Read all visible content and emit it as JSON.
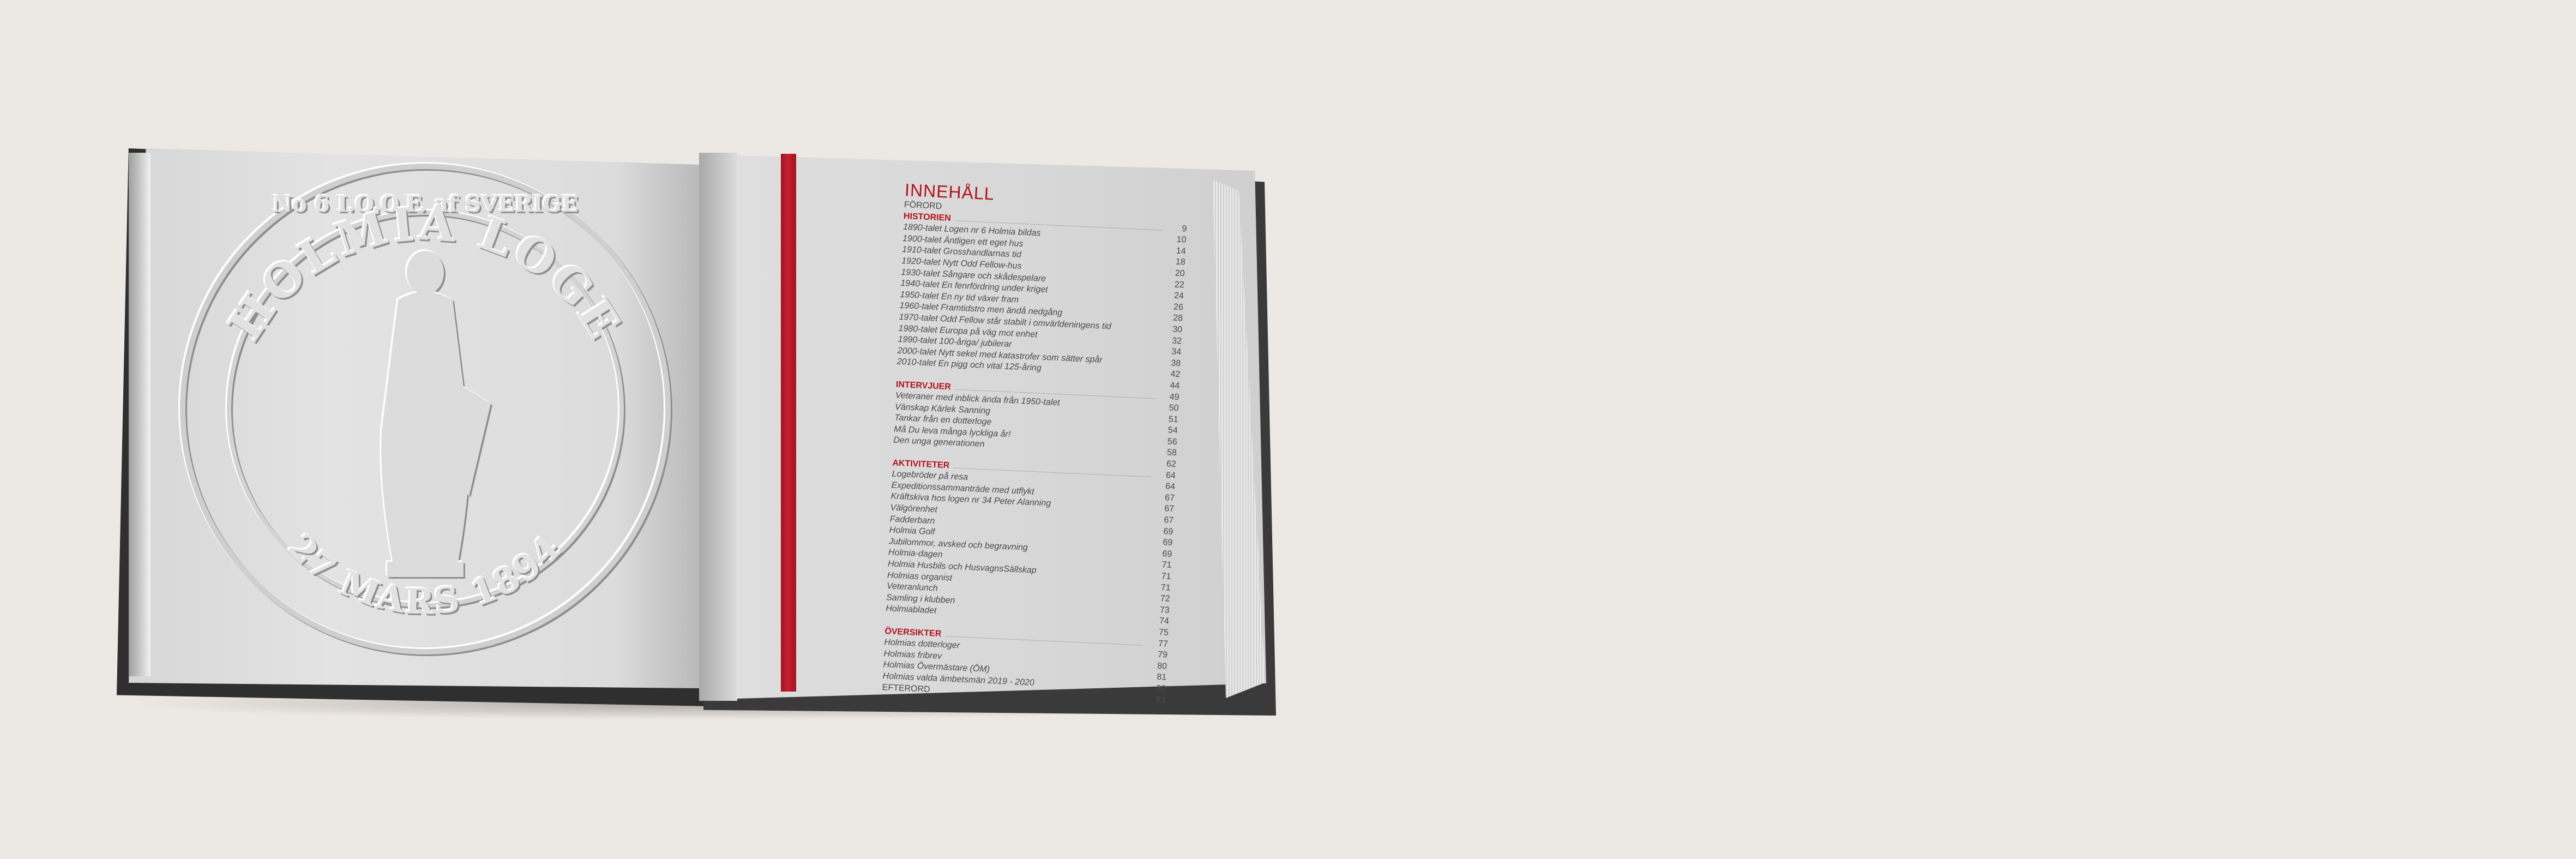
{
  "seal": {
    "top_text": "HOLMIA LOGE",
    "number_text": "No 6 I.O.O.F. af SVERIGE",
    "date_text": "27 MARS 1894"
  },
  "toc": {
    "title": "INNEHÅLL",
    "rows": [
      {
        "label": "FÖRORD",
        "page": "",
        "kind": "plain"
      },
      {
        "label": "HISTORIEN",
        "page": "9",
        "kind": "section"
      },
      {
        "label": "1890-talet Logen nr 6 Holmia bildas",
        "page": "10",
        "kind": "item"
      },
      {
        "label": "1900-talet Äntligen ett eget hus",
        "page": "14",
        "kind": "item"
      },
      {
        "label": "1910-talet Grosshandlarnas tid",
        "page": "18",
        "kind": "item"
      },
      {
        "label": "1920-talet Nytt Odd Fellow-hus",
        "page": "20",
        "kind": "item"
      },
      {
        "label": "1930-talet Sångare och skådespelare",
        "page": "22",
        "kind": "item"
      },
      {
        "label": "1940-talet En fenrfördring under kriget",
        "page": "24",
        "kind": "item"
      },
      {
        "label": "1950-talet En ny tid växer fram",
        "page": "26",
        "kind": "item"
      },
      {
        "label": "1960-talet Framtidstro men ändå nedgång",
        "page": "28",
        "kind": "item"
      },
      {
        "label": "1970-talet Odd Fellow står stabilt i omvärldeningens tid",
        "page": "30",
        "kind": "item"
      },
      {
        "label": "1980-talet Europa på väg mot enhet",
        "page": "32",
        "kind": "item"
      },
      {
        "label": "1990-talet 100-åriga/ jubilerar",
        "page": "34",
        "kind": "item"
      },
      {
        "label": "2000-talet Nytt sekel med katastrofer som sätter spår",
        "page": "38",
        "kind": "item"
      },
      {
        "label": "2010-talet En pigg och vital 125-åring",
        "page": "42",
        "kind": "item"
      },
      {
        "label": "",
        "page": "44",
        "kind": "item"
      },
      {
        "label": "INTERVJUER",
        "page": "49",
        "kind": "section"
      },
      {
        "label": "Veteraner med inblick ända från 1950-talet",
        "page": "50",
        "kind": "item"
      },
      {
        "label": "Vänskap Kärlek Sanning",
        "page": "51",
        "kind": "item"
      },
      {
        "label": "Tankar från en dotterloge",
        "page": "54",
        "kind": "item"
      },
      {
        "label": "Må Du leva många lyckliga år!",
        "page": "56",
        "kind": "item"
      },
      {
        "label": "Den unga generationen",
        "page": "58",
        "kind": "item"
      },
      {
        "label": "",
        "page": "62",
        "kind": "item"
      },
      {
        "label": "AKTIVITETER",
        "page": "64",
        "kind": "section"
      },
      {
        "label": "Logebröder på resa",
        "page": "64",
        "kind": "item"
      },
      {
        "label": "Expeditionssammanträde med utflykt",
        "page": "67",
        "kind": "item"
      },
      {
        "label": "Kräftskiva hos logen nr 34 Peter Alanning",
        "page": "67",
        "kind": "item"
      },
      {
        "label": "Välgörenhet",
        "page": "67",
        "kind": "item"
      },
      {
        "label": "Fadderbarn",
        "page": "69",
        "kind": "item"
      },
      {
        "label": "Holmia Golf",
        "page": "69",
        "kind": "item"
      },
      {
        "label": "Jubilommor, avsked och begravning",
        "page": "69",
        "kind": "item"
      },
      {
        "label": "Holmia-dagen",
        "page": "71",
        "kind": "item"
      },
      {
        "label": "Holmia Husbils och HusvagnsSällskap",
        "page": "71",
        "kind": "item"
      },
      {
        "label": "Holmias organist",
        "page": "71",
        "kind": "item"
      },
      {
        "label": "Veteranlunch",
        "page": "72",
        "kind": "item"
      },
      {
        "label": "Samling i klubben",
        "page": "73",
        "kind": "item"
      },
      {
        "label": "Holmiabladet",
        "page": "74",
        "kind": "item"
      },
      {
        "label": "",
        "page": "75",
        "kind": "item"
      },
      {
        "label": "ÖVERSIKTER",
        "page": "77",
        "kind": "section"
      },
      {
        "label": "Holmias dotterloger",
        "page": "79",
        "kind": "item"
      },
      {
        "label": "Holmias fribrev",
        "page": "80",
        "kind": "item"
      },
      {
        "label": "Holmias Övermästare (ÖM)",
        "page": "81",
        "kind": "item"
      },
      {
        "label": "Holmias valda ämbetsmän 2019 - 2020",
        "page": "82",
        "kind": "item"
      },
      {
        "label": "EFTERORD",
        "page": "83",
        "kind": "plain"
      }
    ]
  },
  "colors": {
    "background": "#ece8e4",
    "accent_red": "#b3121e",
    "ribbon": "#c6202f"
  }
}
